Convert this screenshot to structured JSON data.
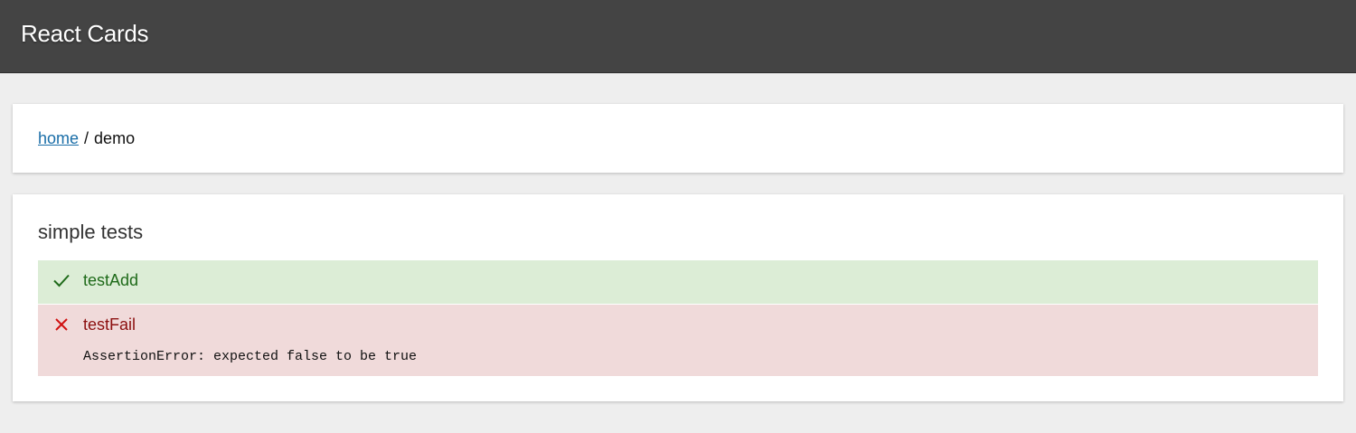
{
  "header": {
    "title": "React Cards"
  },
  "breadcrumb": {
    "home_label": "home",
    "separator": "/",
    "current": "demo"
  },
  "tests": {
    "title": "simple tests",
    "items": [
      {
        "name": "testAdd",
        "status": "pass",
        "icon": "check-icon",
        "color": "#1f6b1a",
        "background": "#dcedd6"
      },
      {
        "name": "testFail",
        "status": "fail",
        "icon": "cross-icon",
        "color": "#d01111",
        "background": "#f0dada",
        "error": "AssertionError: expected false to be true"
      }
    ]
  },
  "colors": {
    "header_bg": "#444444",
    "page_bg": "#eeeeee",
    "link": "#1a6ea8"
  }
}
